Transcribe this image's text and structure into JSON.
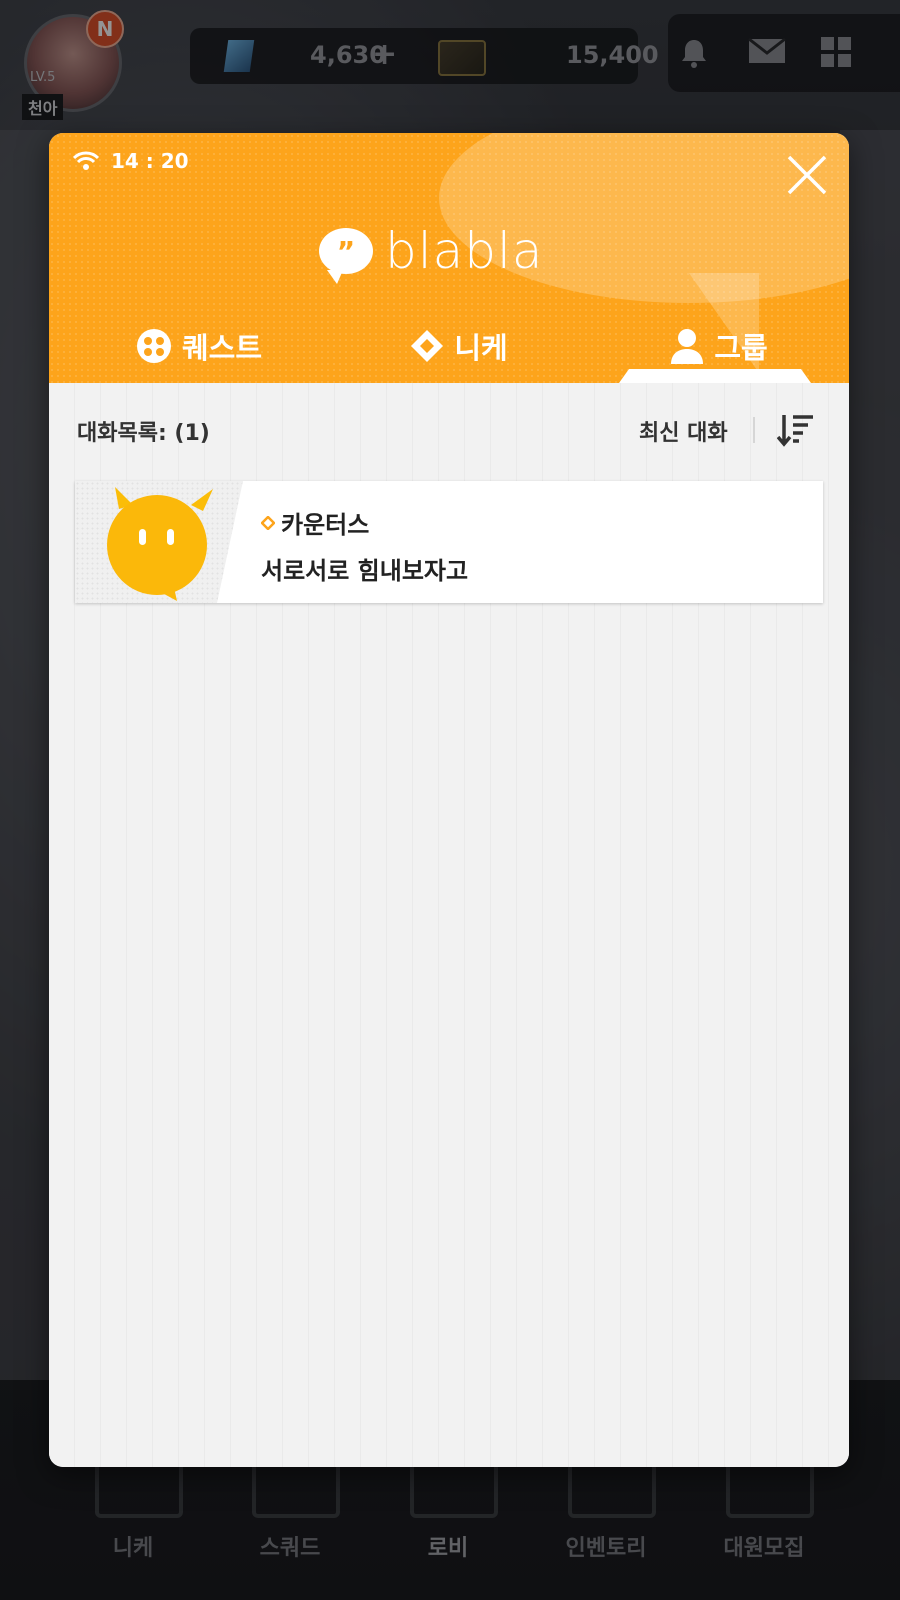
{
  "background": {
    "player": {
      "badge": "N",
      "level": "LV.5",
      "name": "천아"
    },
    "currency": {
      "gems": "4,630",
      "gems_plus": "+",
      "tickets": "15,400"
    },
    "top_icons": [
      "bell-icon",
      "mail-icon",
      "grid-menu-icon"
    ],
    "bottom_nav": [
      {
        "label": "니케",
        "icon": "nikke-icon"
      },
      {
        "label": "스쿼드",
        "icon": "squad-icon"
      },
      {
        "label": "로비",
        "icon": "lobby-icon",
        "active": true
      },
      {
        "label": "인벤토리",
        "icon": "inventory-icon"
      },
      {
        "label": "대원모집",
        "icon": "recruit-icon"
      }
    ]
  },
  "modal": {
    "status": {
      "time": "14 : 20",
      "icon": "wifi-icon"
    },
    "logo": {
      "text": "blabla",
      "icon": "speech-bubble-icon"
    },
    "close_icon": "close-icon",
    "tabs": [
      {
        "label": "퀘스트",
        "icon": "quest-icon",
        "active": false
      },
      {
        "label": "니케",
        "icon": "diamond-icon",
        "active": false
      },
      {
        "label": "그룹",
        "icon": "person-icon",
        "active": true
      }
    ],
    "list_header": {
      "count_label": "대화목록: (1)",
      "sort_label": "최신 대화",
      "sort_icon": "sort-icon"
    },
    "chats": [
      {
        "name": "카운터스",
        "message": "서로서로 힘내보자고",
        "icon": "diamond-icon"
      }
    ],
    "colors": {
      "accent": "#fda41b",
      "body_bg": "#f2f2f2"
    }
  }
}
